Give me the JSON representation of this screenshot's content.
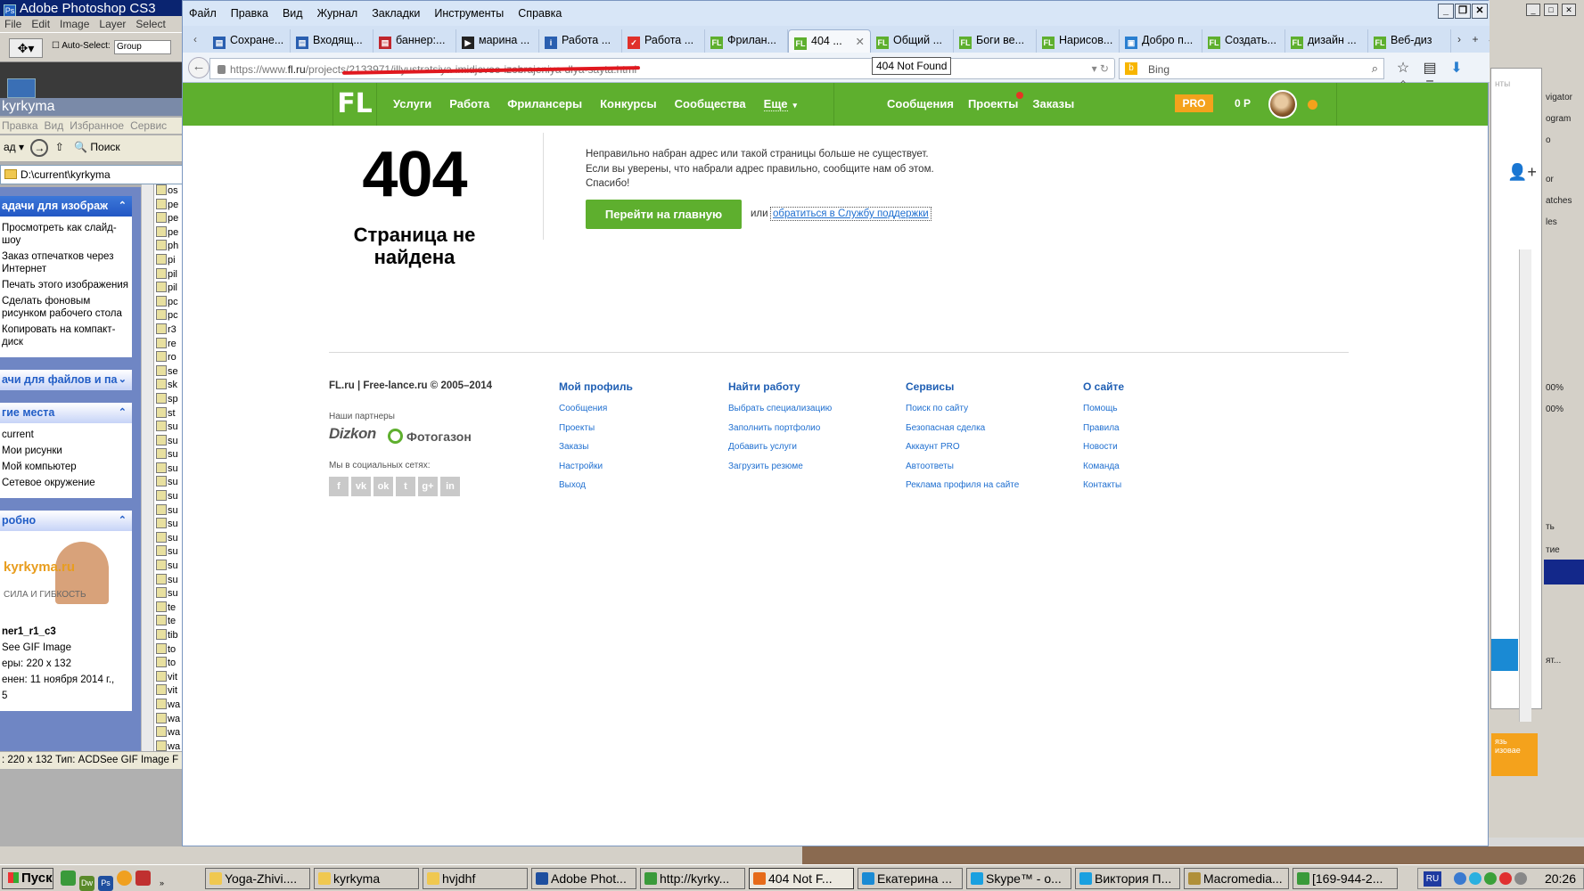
{
  "photoshop": {
    "title": "Adobe Photoshop CS3",
    "app_icon": "Ps",
    "menu": [
      "File",
      "Edit",
      "Image",
      "Layer",
      "Select"
    ],
    "auto_select_label": "Auto-Select:",
    "auto_select_value": "Group"
  },
  "explorer": {
    "title": "kyrkyma",
    "menu": [
      "Правка",
      "Вид",
      "Избранное",
      "Сервис"
    ],
    "back_label": "ад",
    "search_label": "Поиск",
    "address": "D:\\current\\kyrkyma",
    "tasks_image_title": "адачи для изображ",
    "tasks_image_items": [
      "Просмотреть как слайд-шоу",
      "Заказ отпечатков через Интернет",
      "Печать этого изображения",
      "Сделать фоновым рисунком рабочего стола",
      "Копировать на компакт-диск"
    ],
    "tasks_files_title": "ачи для файлов и па",
    "places_title": "гие места",
    "places_items": [
      "current",
      "Мои рисунки",
      "Мой компьютер",
      "Сетевое окружение"
    ],
    "details_title": "робно",
    "details_thumb_brand": "kyrkyma.ru",
    "details_thumb_small": "СИЛА И ГИБКОСТЬ",
    "details_name": "ner1_r1_c3",
    "details_type": "See GIF Image",
    "details_size": "еры: 220 x 132",
    "details_date": "енен: 11 ноября 2014 г.,",
    "details_extra": "5",
    "files": [
      "os",
      "pe",
      "pe",
      "pe",
      "ph",
      "pi",
      "pil",
      "pil",
      "pc",
      "pc",
      "r3",
      "re",
      "ro",
      "se",
      "sk",
      "sp",
      "st",
      "su",
      "su",
      "su",
      "su",
      "su",
      "su",
      "su",
      "su",
      "su",
      "su",
      "su",
      "su",
      "su",
      "te",
      "te",
      "tib",
      "to",
      "to",
      "vit",
      "vit",
      "wa",
      "wa",
      "wa",
      "wa"
    ],
    "status": ": 220 x 132 Тип: ACDSee GIF Image F"
  },
  "firefox": {
    "menu": [
      "Файл",
      "Правка",
      "Вид",
      "Журнал",
      "Закладки",
      "Инструменты",
      "Справка"
    ],
    "tabs": [
      {
        "label": "Сохране...",
        "fav": "doc",
        "color": "#2a5fb0",
        "glyph": "▤"
      },
      {
        "label": "Входящ...",
        "fav": "mail",
        "color": "#2a5fb0",
        "glyph": "▤"
      },
      {
        "label": "баннер:...",
        "fav": "pdf",
        "color": "#c0262d",
        "glyph": "▤"
      },
      {
        "label": "марина ...",
        "fav": "video",
        "color": "#222",
        "glyph": "▶"
      },
      {
        "label": "Работа ...",
        "fav": "info",
        "color": "#2a5fb0",
        "glyph": "i"
      },
      {
        "label": "Работа ...",
        "fav": "check",
        "color": "#e0302a",
        "glyph": "✓"
      },
      {
        "label": "Фрилан...",
        "fav": "fl",
        "color": "#5eaf2e",
        "glyph": "FL"
      },
      {
        "label": "404 ...",
        "fav": "fl",
        "color": "#5eaf2e",
        "glyph": "FL",
        "active": true
      },
      {
        "label": "Общий ...",
        "fav": "fl",
        "color": "#5eaf2e",
        "glyph": "FL"
      },
      {
        "label": "Боги ве...",
        "fav": "fl",
        "color": "#5eaf2e",
        "glyph": "FL"
      },
      {
        "label": "Нарисов...",
        "fav": "fl",
        "color": "#5eaf2e",
        "glyph": "FL"
      },
      {
        "label": "Добро п...",
        "fav": "doc",
        "color": "#2a7fd0",
        "glyph": "▣"
      },
      {
        "label": "Создать...",
        "fav": "fl",
        "color": "#5eaf2e",
        "glyph": "FL"
      },
      {
        "label": "дизайн ...",
        "fav": "fl",
        "color": "#5eaf2e",
        "glyph": "FL"
      },
      {
        "label": "Веб-диз",
        "fav": "fl",
        "color": "#5eaf2e",
        "glyph": "FL"
      }
    ],
    "url_prefix": "https://www.",
    "url_host": "fl.ru",
    "url_path": "/projects/2133971/illyustratsiya-imidjevoe-izobrajeniya-dlya-sayta.html",
    "tooltip": "404 Not Found",
    "search_placeholder": "Bing"
  },
  "fl": {
    "logo": "FL",
    "nav": [
      "Услуги",
      "Работа",
      "Фрилансеры",
      "Конкурсы",
      "Сообщества"
    ],
    "more": "Еще",
    "right_nav": [
      "Сообщения",
      "Проекты",
      "Заказы"
    ],
    "pro": "PRO",
    "balance": "0 Р",
    "error_code": "404",
    "error_title": "Страница не найдена",
    "error_msg_1": "Неправильно набран адрес или такой страницы больше не существует.",
    "error_msg_2": "Если вы уверены, что набрали адрес правильно, сообщите нам об этом.",
    "error_msg_3": "Спасибо!",
    "go_home": "Перейти на главную",
    "or": "или",
    "support_link": "обратиться в Службу поддержки",
    "footer": {
      "copyright": "FL.ru | Free-lance.ru © 2005–2014",
      "partners_label": "Наши партнеры",
      "partner_1": "Dizkon",
      "partner_2": "Фотогазон",
      "social_label": "Мы в социальных сетях:",
      "social": [
        "f",
        "vk",
        "ok",
        "tw",
        "g+",
        "in"
      ],
      "columns": [
        {
          "title": "Мой профиль",
          "links": [
            "Сообщения",
            "Проекты",
            "Заказы",
            "Настройки",
            "Выход"
          ]
        },
        {
          "title": "Найти работу",
          "links": [
            "Выбрать специализацию",
            "Заполнить портфолио",
            "Добавить услуги",
            "Загрузить резюме"
          ]
        },
        {
          "title": "Сервисы",
          "links": [
            "Поиск по сайту",
            "Безопасная сделка",
            "Аккаунт PRO",
            "Автоответы",
            "Реклама профиля на сайте"
          ]
        },
        {
          "title": "О сайте",
          "links": [
            "Помощь",
            "Правила",
            "Новости",
            "Команда",
            "Контакты"
          ]
        }
      ]
    }
  },
  "right_window": {
    "items": [
      "vigator",
      "ogram",
      "o",
      "or",
      "atches",
      "les",
      "ть",
      "тие",
      "ят..."
    ],
    "overflow": "нты",
    "orange_text": "язь",
    "orange_sub": "изовае",
    "zoom_1": "00%",
    "zoom_2": "00%"
  },
  "taskbar": {
    "start": "Пуск",
    "buttons": [
      {
        "label": "Yoga-Zhivi....",
        "color": "#f0c850"
      },
      {
        "label": "kyrkyma",
        "color": "#f0c850"
      },
      {
        "label": "hvjdhf",
        "color": "#f0c850"
      },
      {
        "label": "Adobe Phot...",
        "color": "#1f4f9f"
      },
      {
        "label": "http://kyrky...",
        "color": "#3a9a3a"
      },
      {
        "label": "404 Not F...",
        "color": "#e66b1a",
        "pressed": true
      },
      {
        "label": "Екатерина ...",
        "color": "#1a8ad4"
      },
      {
        "label": "Skype™ - o...",
        "color": "#1aa0e0"
      },
      {
        "label": "Виктория П...",
        "color": "#1aa0e0"
      },
      {
        "label": "Macromedia...",
        "color": "#b0903a"
      },
      {
        "label": "[169-944-2...",
        "color": "#3a9a3a"
      }
    ],
    "lang": "RU",
    "clock": "20:26"
  }
}
